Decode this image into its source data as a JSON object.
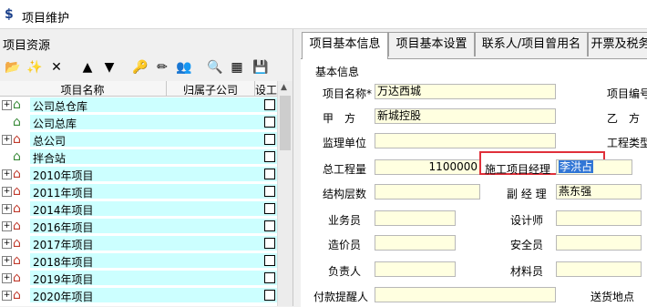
{
  "window": {
    "title": "项目维护"
  },
  "left": {
    "header": "项目资源",
    "toolbar": [
      {
        "name": "open-folder-icon",
        "glyph": "📂"
      },
      {
        "name": "new-item-icon",
        "glyph": "✨"
      },
      {
        "name": "delete-icon",
        "glyph": "✕"
      },
      {
        "name": "move-up-icon",
        "glyph": "▲"
      },
      {
        "name": "move-down-icon",
        "glyph": "▼"
      },
      {
        "name": "key-icon",
        "glyph": "🔑"
      },
      {
        "name": "eraser-icon",
        "glyph": "✏"
      },
      {
        "name": "users-icon",
        "glyph": "👥"
      },
      {
        "name": "find-icon",
        "glyph": "🔍"
      },
      {
        "name": "grid-icon",
        "glyph": "▦"
      },
      {
        "name": "save-icon",
        "glyph": "💾"
      }
    ],
    "columns": {
      "name": "项目名称",
      "parent": "归属子公司",
      "flag": "设工"
    },
    "rows": [
      {
        "label": "公司总仓库",
        "icon": "store",
        "expandable": true
      },
      {
        "label": "公司总库",
        "icon": "store",
        "expandable": false
      },
      {
        "label": "总公司",
        "icon": "home",
        "expandable": true
      },
      {
        "label": "拌合站",
        "icon": "store",
        "expandable": false
      },
      {
        "label": "2010年项目",
        "icon": "home",
        "expandable": true
      },
      {
        "label": "2011年项目",
        "icon": "home",
        "expandable": true
      },
      {
        "label": "2014年项目",
        "icon": "home",
        "expandable": true
      },
      {
        "label": "2016年项目",
        "icon": "home",
        "expandable": true
      },
      {
        "label": "2017年项目",
        "icon": "home",
        "expandable": true
      },
      {
        "label": "2018年项目",
        "icon": "home",
        "expandable": true
      },
      {
        "label": "2019年项目",
        "icon": "home",
        "expandable": true
      },
      {
        "label": "2020年项目",
        "icon": "home",
        "expandable": true
      }
    ]
  },
  "tabs": [
    "项目基本信息",
    "项目基本设置",
    "联系人/项目曾用名",
    "开票及税务"
  ],
  "form": {
    "section": "基本信息",
    "project_name_label": "项目名称*",
    "project_name_value": "万达西城",
    "project_code_label": "项目编号",
    "party_a_label": "甲　方",
    "party_a_value": "新城控股",
    "party_b_label": "乙　方",
    "supervisor_label": "监理单位",
    "project_type_label": "工程类型",
    "total_amount_label": "总工程量",
    "total_amount_value": "1100000",
    "construction_manager_label": "施工项目经理",
    "construction_manager_value": "李洪占",
    "structure_floors_label": "结构层数",
    "deputy_manager_label": "副 经 理",
    "deputy_manager_value": "燕东强",
    "clerk_label": "业务员",
    "designer_label": "设计师",
    "cost_estimator_label": "造价员",
    "safety_officer_label": "安全员",
    "responsible_label": "负责人",
    "material_officer_label": "材料员",
    "payment_reminder_label": "付款提醒人",
    "delivery_location_label": "送货地点"
  }
}
